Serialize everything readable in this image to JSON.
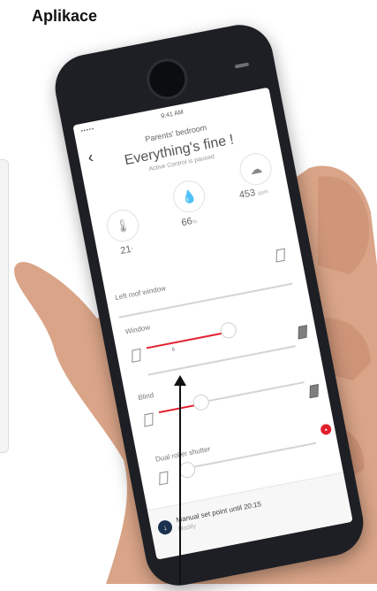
{
  "caption": "Aplikace",
  "app": {
    "status_time": "9:41 AM",
    "status_signal": "•••••",
    "room_name": "Parents' bedroom",
    "headline": "Everything's fine !",
    "subline": "Active Control is paused",
    "metrics": [
      {
        "icon": "thermometer-icon",
        "value": "21",
        "unit": "°"
      },
      {
        "icon": "humidity-drop-icon",
        "value": "66",
        "unit": "%"
      },
      {
        "icon": "co2-cloud-icon",
        "value": "453",
        "unit": "ppm"
      }
    ],
    "devices": [
      {
        "label": "Left roof window",
        "control_label": "Window",
        "marker": "6"
      },
      {
        "label": "Blind"
      },
      {
        "label": "Dual roller shutter"
      }
    ],
    "manual": {
      "text": "Manual set point until 20:15",
      "link": "Modify"
    }
  },
  "colors": {
    "accent": "#e2202e",
    "phone_body": "#1d1f24",
    "manual_icon_bg": "#1b3150"
  }
}
